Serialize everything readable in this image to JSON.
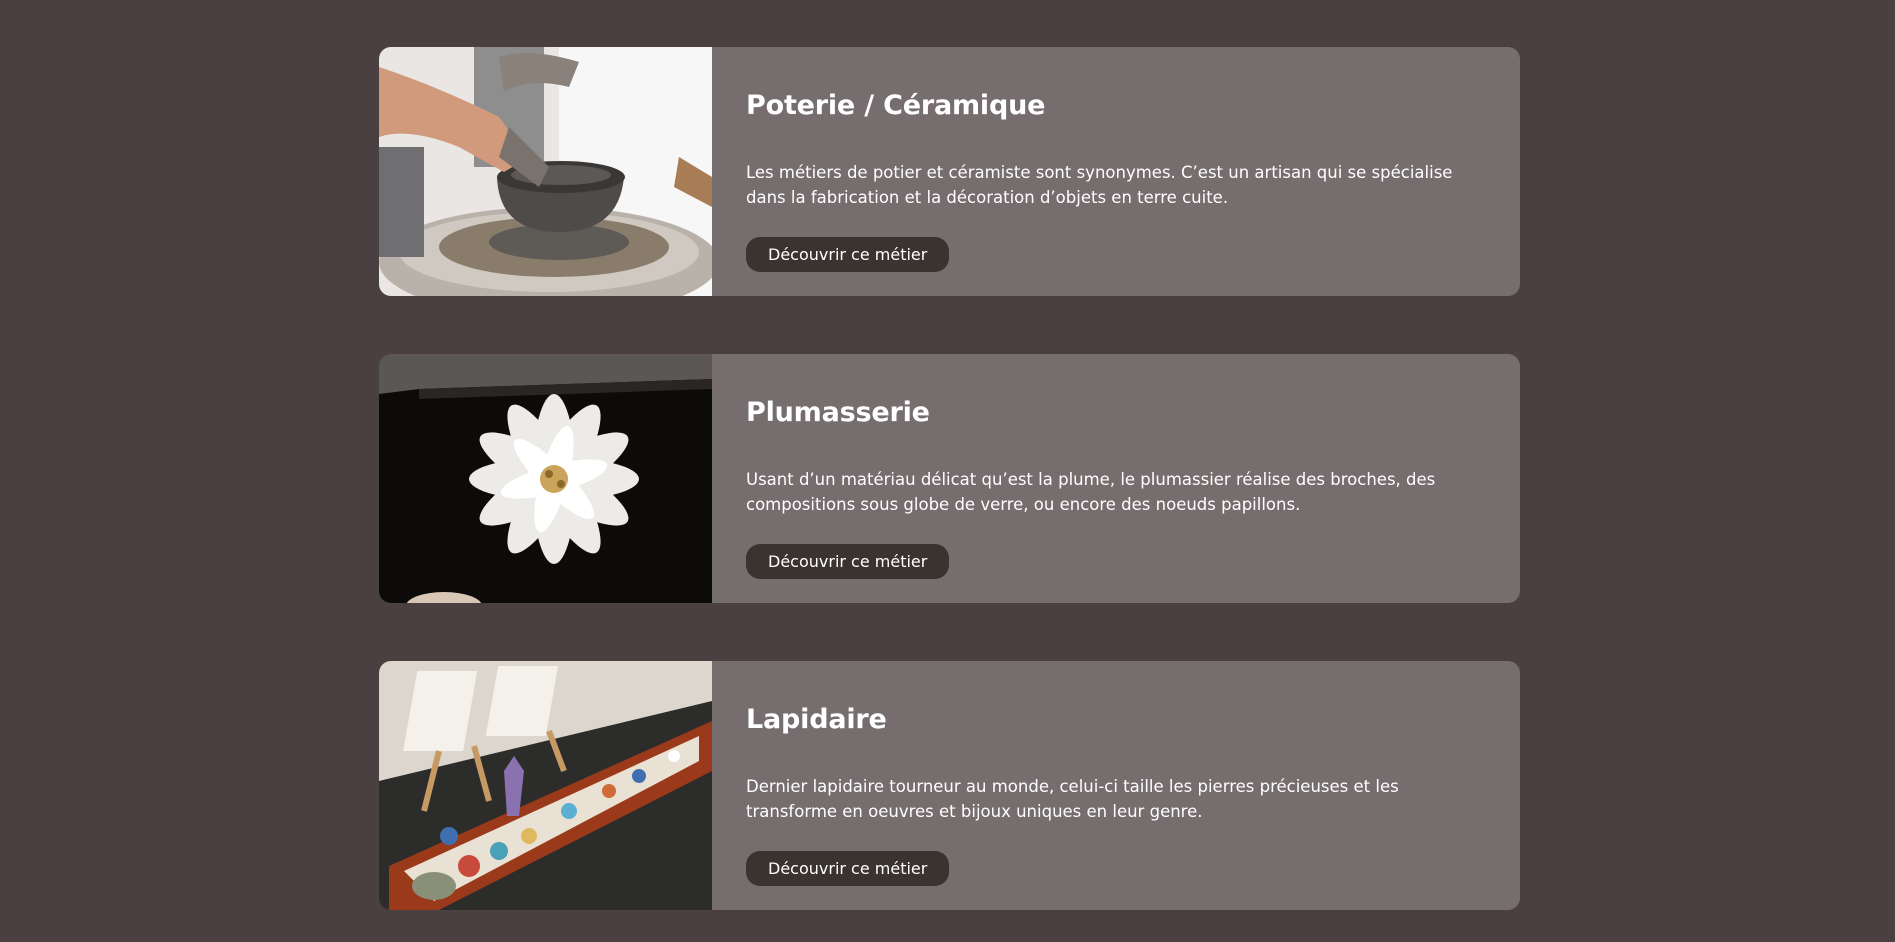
{
  "cards": [
    {
      "title": "Poterie / Céramique",
      "description": "Les métiers de potier et céramiste sont synonymes. C’est un artisan qui se spécialise dans la fabrication et la décoration d’objets en terre cuite.",
      "button_label": "Découvrir ce métier",
      "image_icon": "pottery-wheel-image"
    },
    {
      "title": "Plumasserie",
      "description": "Usant d’un matériau délicat qu’est la plume, le plumassier réalise des broches, des compositions sous globe de verre, ou encore des noeuds papillons.",
      "button_label": "Découvrir ce métier",
      "image_icon": "feather-flower-image"
    },
    {
      "title": "Lapidaire",
      "description": "Dernier lapidaire tourneur au monde, celui-ci taille les pierres précieuses et les transforme en oeuvres et bijoux uniques en leur genre.",
      "button_label": "Découvrir ce métier",
      "image_icon": "gemstone-display-image"
    }
  ],
  "colors": {
    "page_background": "#4a4042",
    "card_background": "#766d6e",
    "button_background": "#3b3330",
    "text": "#ffffff"
  }
}
